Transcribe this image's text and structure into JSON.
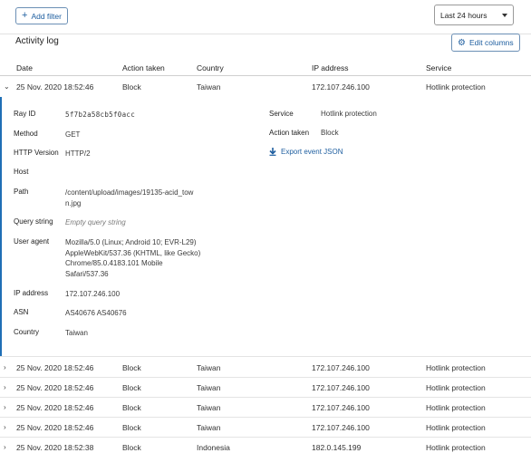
{
  "toolbar": {
    "add_filter_label": "Add filter",
    "time_range": "Last 24 hours"
  },
  "activity": {
    "title": "Activity log",
    "edit_columns_label": "Edit columns"
  },
  "table": {
    "columns": [
      "Date",
      "Action taken",
      "Country",
      "IP address",
      "Service"
    ],
    "expanded_row": {
      "date": "25 Nov. 2020 18:52:46",
      "action": "Block",
      "country": "Taiwan",
      "ip": "172.107.246.100",
      "service": "Hotlink protection"
    },
    "rows": [
      {
        "date": "25 Nov. 2020 18:52:46",
        "action": "Block",
        "country": "Taiwan",
        "ip": "172.107.246.100",
        "service": "Hotlink protection"
      },
      {
        "date": "25 Nov. 2020 18:52:46",
        "action": "Block",
        "country": "Taiwan",
        "ip": "172.107.246.100",
        "service": "Hotlink protection"
      },
      {
        "date": "25 Nov. 2020 18:52:46",
        "action": "Block",
        "country": "Taiwan",
        "ip": "172.107.246.100",
        "service": "Hotlink protection"
      },
      {
        "date": "25 Nov. 2020 18:52:46",
        "action": "Block",
        "country": "Taiwan",
        "ip": "172.107.246.100",
        "service": "Hotlink protection"
      },
      {
        "date": "25 Nov. 2020 18:52:38",
        "action": "Block",
        "country": "Indonesia",
        "ip": "182.0.145.199",
        "service": "Hotlink protection"
      }
    ]
  },
  "detail": {
    "ray_id_label": "Ray ID",
    "ray_id": "5f7b2a58cb5f0acc",
    "method_label": "Method",
    "method": "GET",
    "http_version_label": "HTTP Version",
    "http_version": "HTTP/2",
    "host_label": "Host",
    "path_label": "Path",
    "path_line1": "/content/upload/images/19135-acid_tow",
    "path_line2": "n.jpg",
    "query_label": "Query string",
    "query": "Empty query string",
    "ua_label": "User agent",
    "ua_line1": "Mozilla/5.0 (Linux; Android 10; EVR-L29)",
    "ua_line2": "AppleWebKit/537.36 (KHTML, like Gecko)",
    "ua_line3": "Chrome/85.0.4183.101 Mobile",
    "ua_line4": "Safari/537.36",
    "ip_label": "IP address",
    "ip": "172.107.246.100",
    "asn_label": "ASN",
    "asn": "AS40676 AS40676",
    "country_label": "Country",
    "country": "Taiwan",
    "service_label": "Service",
    "service": "Hotlink protection",
    "action_label": "Action taken",
    "action": "Block",
    "export_label": "Export event JSON"
  },
  "colors": {
    "accent": "#1f6fb5",
    "link": "#1f5fa0"
  },
  "icons": [
    "plus-icon",
    "chevron-down-icon",
    "gear-icon",
    "chevron-right-icon",
    "download-icon"
  ]
}
